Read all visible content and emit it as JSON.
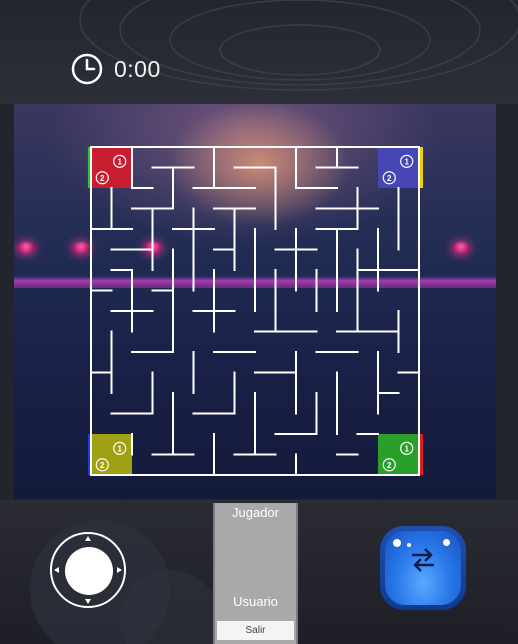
{
  "timer": {
    "icon": "clock-icon",
    "value": "0:00"
  },
  "maze": {
    "size": 16,
    "wall_color": "#ffffff",
    "corners": [
      {
        "id": "red",
        "color": "#c81e32",
        "edge_color": "#28c832",
        "tokens": [
          "1",
          "2"
        ]
      },
      {
        "id": "blue",
        "color": "#4646b4",
        "edge_color": "#f0d000",
        "tokens": [
          "1",
          "2"
        ]
      },
      {
        "id": "yellow",
        "color": "#a0a014",
        "edge_color": "#1e3cdc",
        "tokens": [
          "1",
          "2"
        ]
      },
      {
        "id": "green",
        "color": "#2aa02a",
        "edge_color": "#dc1e1e",
        "tokens": [
          "1",
          "2"
        ]
      }
    ]
  },
  "panel": {
    "title": "Jugador",
    "user_label": "Usuario",
    "exit_button": "Salir"
  },
  "controls": {
    "joystick": "joystick-control",
    "action": "swap-arrows-icon"
  }
}
